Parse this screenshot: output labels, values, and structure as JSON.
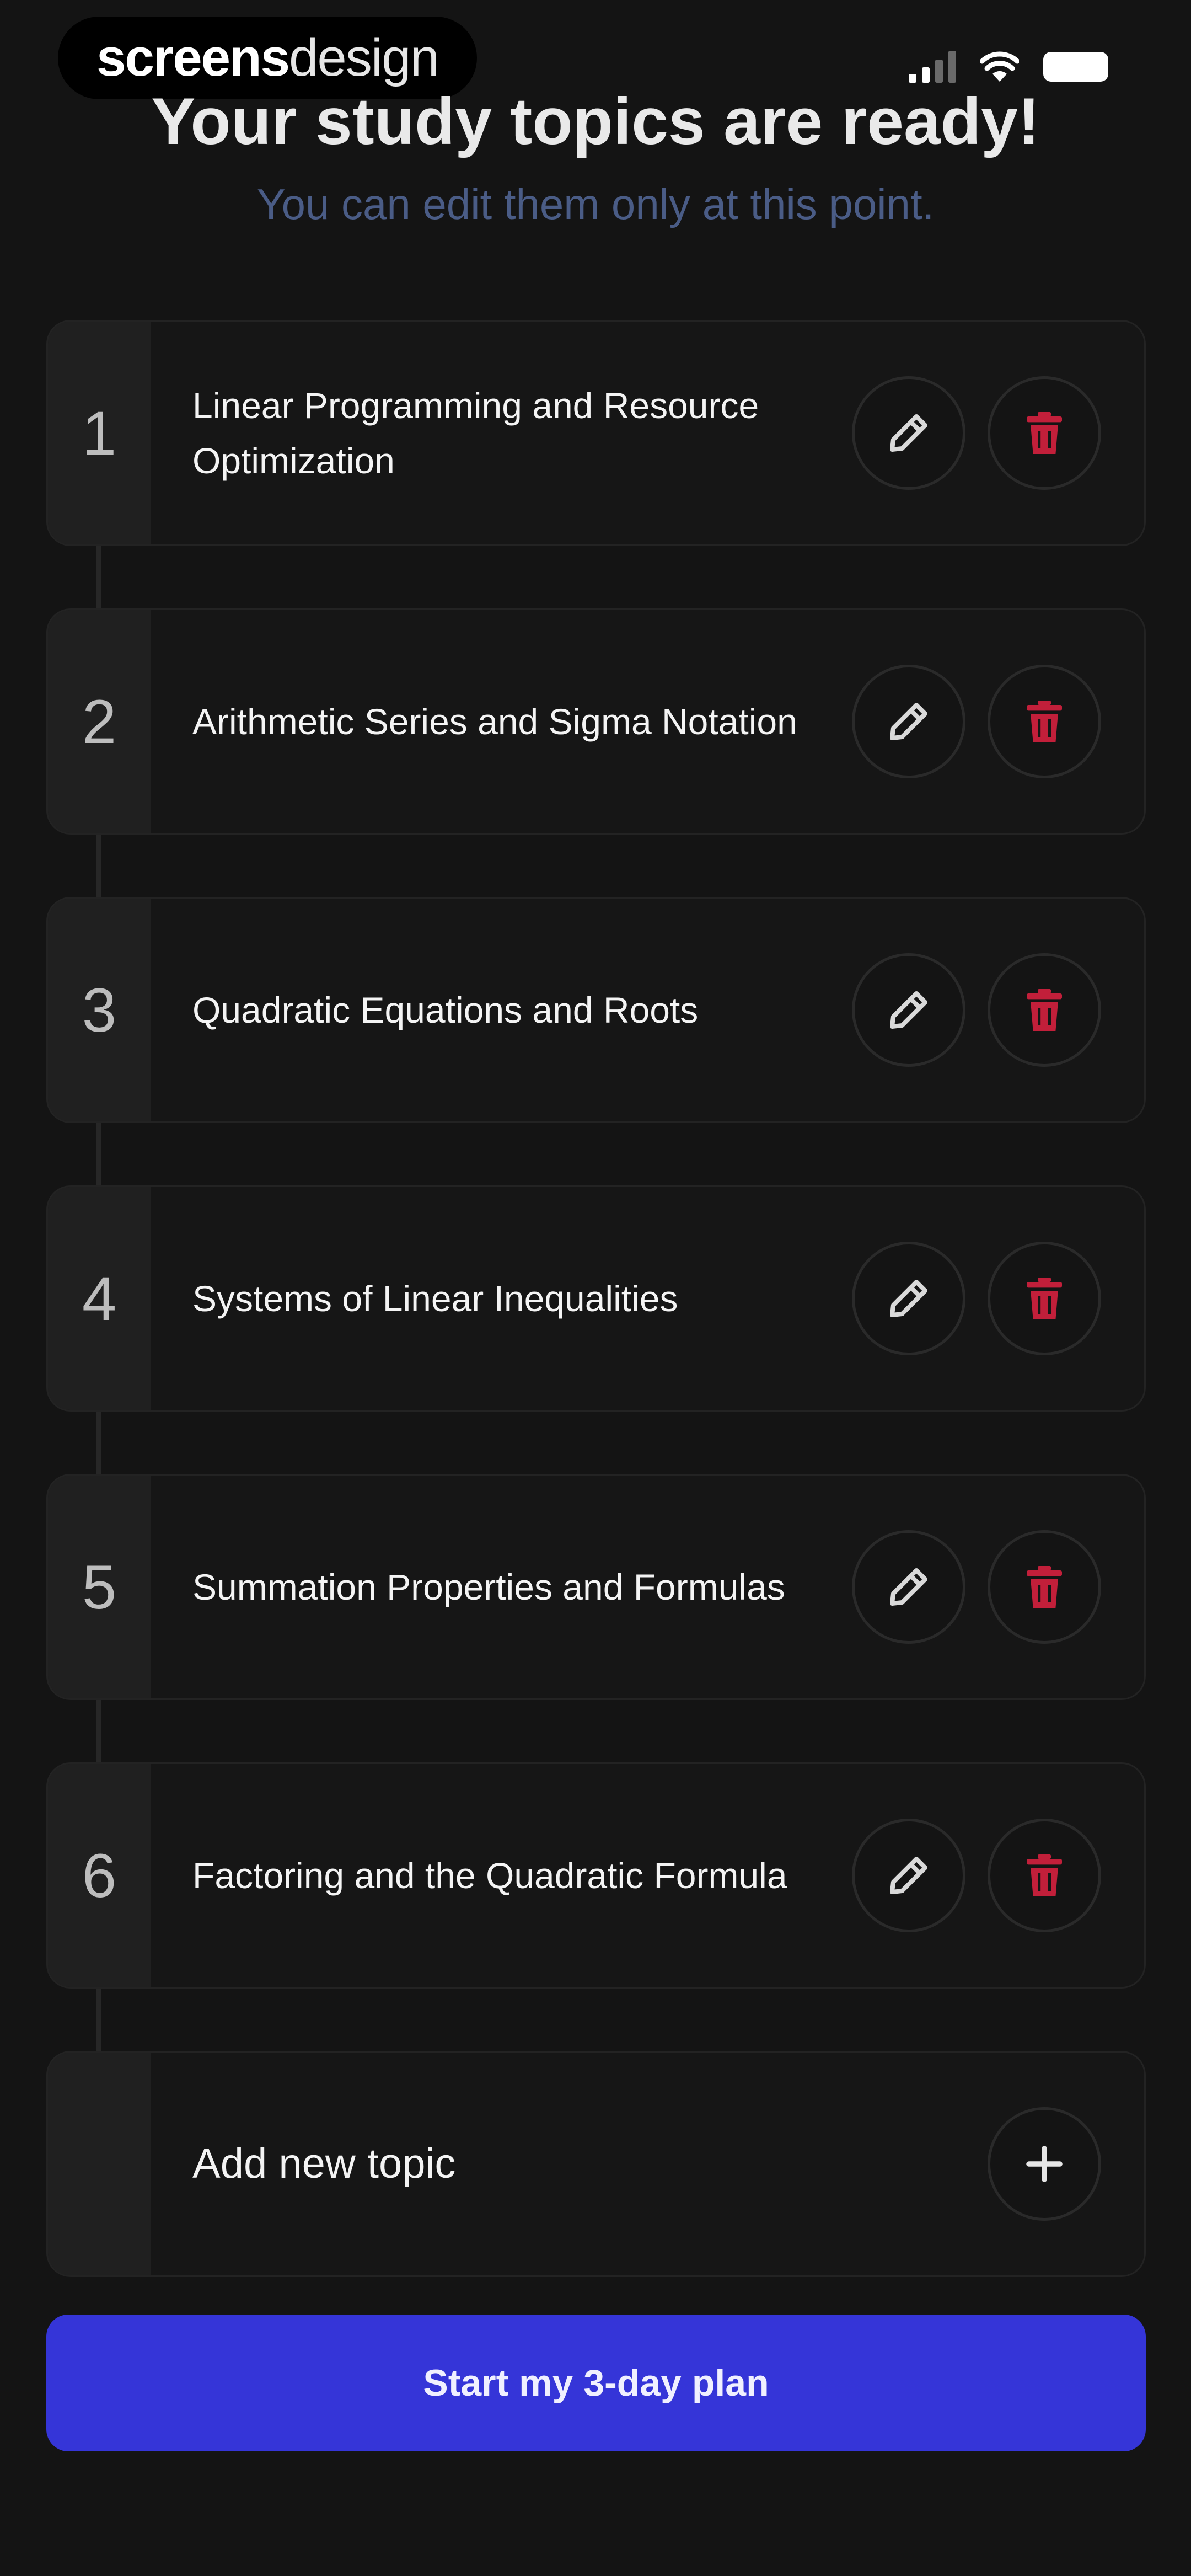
{
  "status_bar": {
    "brand_part1": "screens",
    "brand_part2": "design"
  },
  "header": {
    "title": "Your study topics are ready!",
    "subtitle": "You can edit them only at this point."
  },
  "topics": [
    {
      "number": "1",
      "label": "Linear Programming and Resource Optimization"
    },
    {
      "number": "2",
      "label": "Arithmetic Series and Sigma Notation"
    },
    {
      "number": "3",
      "label": "Quadratic Equations and Roots"
    },
    {
      "number": "4",
      "label": "Systems of Linear Inequalities"
    },
    {
      "number": "5",
      "label": "Summation Properties and Formulas"
    },
    {
      "number": "6",
      "label": "Factoring and the Quadratic Formula"
    }
  ],
  "add_topic": {
    "label": "Add new topic"
  },
  "cta": {
    "label": "Start my 3-day plan"
  },
  "icons": {
    "edit": "pencil-icon",
    "delete": "trash-icon",
    "add": "plus-icon"
  },
  "colors": {
    "background": "#141414",
    "accent": "#3535d8",
    "delete": "#c21f3a",
    "subtitle": "#4a5c86"
  }
}
